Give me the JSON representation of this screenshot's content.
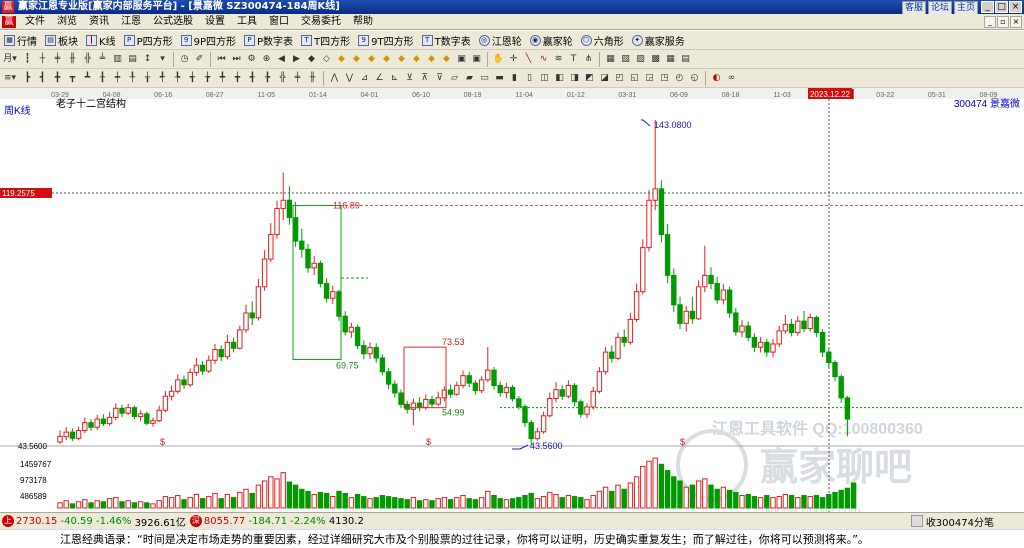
{
  "titlebar": {
    "title": "赢家江恩专业版[赢家内部服务平台] - [景嘉微  SZ300474-184周K线]",
    "links": [
      "客服",
      "论坛",
      "主页"
    ],
    "win_buttons": [
      "_",
      "□",
      "×"
    ]
  },
  "menu": {
    "items": [
      "文件",
      "浏览",
      "资讯",
      "江恩",
      "公式选股",
      "设置",
      "工具",
      "窗口",
      "交易委托",
      "帮助"
    ]
  },
  "toolbar1": {
    "items": [
      {
        "icon": "table-icon",
        "label": "行情"
      },
      {
        "icon": "blocks-icon",
        "label": "板块"
      },
      {
        "icon": "candle-icon",
        "label": "K线"
      },
      {
        "icon": "square-icon",
        "label": "P四方形"
      },
      {
        "icon": "square-9p-icon",
        "label": "9P四方形"
      },
      {
        "icon": "square-p-num-icon",
        "label": "P数字表"
      },
      {
        "icon": "square-t-icon",
        "label": "T四方形"
      },
      {
        "icon": "square-9t-icon",
        "label": "9T四方形"
      },
      {
        "icon": "square-t-num-icon",
        "label": "T数字表"
      },
      {
        "icon": "gann-wheel-icon",
        "label": "江恩轮"
      },
      {
        "icon": "winner-wheel-icon",
        "label": "赢家轮"
      },
      {
        "icon": "hexagon-icon",
        "label": "六角形"
      },
      {
        "icon": "winner-service-icon",
        "label": "赢家服务"
      }
    ]
  },
  "chart": {
    "period_label": "周K线",
    "structure_label": "老子十二宫结构",
    "code_label": "300474 景嘉微",
    "crosshair_date": "2023.12.22",
    "crosshair_price": "119.2575",
    "top_dates": [
      "03-29",
      "04-08",
      "06-16",
      "08-27",
      "11-05",
      "01-14",
      "04-01",
      "06-10",
      "08-19",
      "11-04",
      "01-12",
      "03-31",
      "06-09",
      "08-18",
      "11-03",
      "2023.12.22",
      "03-22",
      "05-31",
      "08-09"
    ],
    "price_labels": {
      "high": "143.0800",
      "resistance": "116.89",
      "box1_low": "69.75",
      "box2_high": "73.53",
      "box2_low": "54.99",
      "low": "43.5600",
      "axis_low": "43.5600"
    },
    "volume_labels": [
      "1459767",
      "973178",
      "486589"
    ],
    "watermark_top": "江恩工具软件  QQ:100800360",
    "watermark_big": "赢家聊吧",
    "watermark_url": "liaoba.yingjia.com",
    "dividend_mark": "$"
  },
  "statusbar": {
    "sh_value": "2730.15",
    "sh_change": "-40.59",
    "sh_pct": "-1.46%",
    "sh_vol": "3926.61亿",
    "sz_value": "8055.77",
    "sz_change": "-184.71",
    "sz_pct": "-2.24%",
    "sz_vol": "4130.2",
    "right_text": "收300474分笔"
  },
  "quote": {
    "text": "江恩经典语录：“时间是决定市场走势的重要因素，经过详细研究大市及个别股票的过往记录，你将可以证明，历史确实重复发生；而了解过往，你将可以预测将来。”。"
  },
  "chart_data": {
    "type": "candlestick",
    "title": "老子十二宫结构",
    "series_name": "300474 景嘉微 周K线",
    "ylim": [
      43.56,
      143.08
    ],
    "highlighted_levels": [
      143.08,
      116.89,
      73.53,
      69.75,
      54.99,
      43.56
    ],
    "candles": [
      {
        "o": 44.5,
        "c": 46.2,
        "h": 48.0,
        "l": 43.9
      },
      {
        "o": 46.1,
        "c": 47.5,
        "h": 49.0,
        "l": 45.0
      },
      {
        "o": 47.5,
        "c": 45.6,
        "h": 48.6,
        "l": 44.8
      },
      {
        "o": 45.6,
        "c": 48.0,
        "h": 49.2,
        "l": 45.0
      },
      {
        "o": 48.0,
        "c": 50.4,
        "h": 52.0,
        "l": 47.2
      },
      {
        "o": 50.4,
        "c": 49.0,
        "h": 51.5,
        "l": 47.8
      },
      {
        "o": 49.0,
        "c": 51.5,
        "h": 52.8,
        "l": 48.1
      },
      {
        "o": 51.5,
        "c": 50.1,
        "h": 53.0,
        "l": 49.4
      },
      {
        "o": 50.1,
        "c": 52.0,
        "h": 53.6,
        "l": 49.5
      },
      {
        "o": 52.0,
        "c": 54.8,
        "h": 56.3,
        "l": 51.2
      },
      {
        "o": 54.8,
        "c": 53.3,
        "h": 55.9,
        "l": 52.1
      },
      {
        "o": 53.3,
        "c": 55.0,
        "h": 56.2,
        "l": 52.8
      },
      {
        "o": 55.0,
        "c": 52.3,
        "h": 55.6,
        "l": 51.5
      },
      {
        "o": 52.3,
        "c": 53.1,
        "h": 54.2,
        "l": 50.8
      },
      {
        "o": 53.1,
        "c": 50.2,
        "h": 53.8,
        "l": 49.6
      },
      {
        "o": 50.2,
        "c": 51.0,
        "h": 52.0,
        "l": 49.1
      },
      {
        "o": 51.0,
        "c": 54.2,
        "h": 55.6,
        "l": 50.6
      },
      {
        "o": 54.2,
        "c": 58.5,
        "h": 60.1,
        "l": 53.6
      },
      {
        "o": 58.5,
        "c": 60.0,
        "h": 61.8,
        "l": 57.2
      },
      {
        "o": 60.0,
        "c": 63.5,
        "h": 65.2,
        "l": 59.3
      },
      {
        "o": 63.5,
        "c": 62.0,
        "h": 64.8,
        "l": 60.8
      },
      {
        "o": 62.0,
        "c": 65.8,
        "h": 67.0,
        "l": 61.3
      },
      {
        "o": 65.8,
        "c": 68.0,
        "h": 70.2,
        "l": 64.7
      },
      {
        "o": 68.0,
        "c": 66.2,
        "h": 69.3,
        "l": 65.0
      },
      {
        "o": 66.2,
        "c": 69.5,
        "h": 71.0,
        "l": 65.6
      },
      {
        "o": 69.5,
        "c": 72.8,
        "h": 74.5,
        "l": 68.4
      },
      {
        "o": 72.8,
        "c": 70.6,
        "h": 74.1,
        "l": 69.2
      },
      {
        "o": 70.6,
        "c": 75.0,
        "h": 77.3,
        "l": 69.8
      },
      {
        "o": 75.0,
        "c": 73.2,
        "h": 76.5,
        "l": 71.9
      },
      {
        "o": 73.2,
        "c": 78.8,
        "h": 80.1,
        "l": 72.8
      },
      {
        "o": 78.8,
        "c": 84.0,
        "h": 86.5,
        "l": 77.9
      },
      {
        "o": 84.0,
        "c": 82.5,
        "h": 87.6,
        "l": 80.3
      },
      {
        "o": 82.5,
        "c": 92.0,
        "h": 94.4,
        "l": 81.7
      },
      {
        "o": 92.0,
        "c": 100.5,
        "h": 103.2,
        "l": 90.8
      },
      {
        "o": 100.5,
        "c": 108.0,
        "h": 111.5,
        "l": 99.6
      },
      {
        "o": 108.0,
        "c": 116.0,
        "h": 118.4,
        "l": 106.7
      },
      {
        "o": 116.0,
        "c": 118.5,
        "h": 127.0,
        "l": 112.4
      },
      {
        "o": 118.5,
        "c": 113.2,
        "h": 122.8,
        "l": 111.0
      },
      {
        "o": 113.2,
        "c": 106.0,
        "h": 118.0,
        "l": 104.2
      },
      {
        "o": 106.0,
        "c": 103.5,
        "h": 109.8,
        "l": 100.9
      },
      {
        "o": 103.5,
        "c": 97.8,
        "h": 105.2,
        "l": 96.3
      },
      {
        "o": 97.8,
        "c": 99.2,
        "h": 101.5,
        "l": 95.6
      },
      {
        "o": 99.2,
        "c": 93.0,
        "h": 100.0,
        "l": 91.8
      },
      {
        "o": 93.0,
        "c": 88.5,
        "h": 94.6,
        "l": 87.2
      },
      {
        "o": 88.5,
        "c": 90.5,
        "h": 92.3,
        "l": 86.8
      },
      {
        "o": 90.5,
        "c": 83.0,
        "h": 91.1,
        "l": 81.6
      },
      {
        "o": 83.0,
        "c": 78.2,
        "h": 84.5,
        "l": 77.1
      },
      {
        "o": 78.2,
        "c": 79.6,
        "h": 81.0,
        "l": 76.4
      },
      {
        "o": 79.6,
        "c": 74.0,
        "h": 80.4,
        "l": 72.9
      },
      {
        "o": 74.0,
        "c": 71.5,
        "h": 75.6,
        "l": 69.8
      },
      {
        "o": 71.5,
        "c": 73.4,
        "h": 75.0,
        "l": 69.9
      },
      {
        "o": 73.4,
        "c": 70.2,
        "h": 74.7,
        "l": 68.8
      },
      {
        "o": 70.2,
        "c": 66.0,
        "h": 71.3,
        "l": 64.9
      },
      {
        "o": 66.0,
        "c": 62.2,
        "h": 67.1,
        "l": 60.6
      },
      {
        "o": 62.2,
        "c": 59.5,
        "h": 63.3,
        "l": 58.1
      },
      {
        "o": 59.5,
        "c": 56.0,
        "h": 60.6,
        "l": 54.8
      },
      {
        "o": 56.0,
        "c": 54.5,
        "h": 57.1,
        "l": 53.2
      },
      {
        "o": 54.5,
        "c": 56.4,
        "h": 57.8,
        "l": 49.6
      },
      {
        "o": 56.4,
        "c": 55.0,
        "h": 58.2,
        "l": 53.9
      },
      {
        "o": 55.0,
        "c": 57.5,
        "h": 59.0,
        "l": 54.3
      },
      {
        "o": 57.5,
        "c": 56.1,
        "h": 58.6,
        "l": 55.0
      },
      {
        "o": 56.1,
        "c": 58.0,
        "h": 59.9,
        "l": 55.5
      },
      {
        "o": 58.0,
        "c": 60.4,
        "h": 61.5,
        "l": 56.9
      },
      {
        "o": 60.4,
        "c": 59.1,
        "h": 62.0,
        "l": 58.0
      },
      {
        "o": 59.1,
        "c": 61.8,
        "h": 63.0,
        "l": 58.6
      },
      {
        "o": 61.8,
        "c": 64.8,
        "h": 66.4,
        "l": 60.9
      },
      {
        "o": 64.8,
        "c": 62.5,
        "h": 66.0,
        "l": 61.3
      },
      {
        "o": 62.5,
        "c": 60.2,
        "h": 63.4,
        "l": 59.0
      },
      {
        "o": 60.2,
        "c": 63.5,
        "h": 64.6,
        "l": 59.5
      },
      {
        "o": 63.5,
        "c": 66.5,
        "h": 73.53,
        "l": 62.8
      },
      {
        "o": 66.5,
        "c": 61.8,
        "h": 67.4,
        "l": 60.6
      },
      {
        "o": 61.8,
        "c": 59.6,
        "h": 63.0,
        "l": 58.4
      },
      {
        "o": 59.6,
        "c": 61.2,
        "h": 62.6,
        "l": 57.9
      },
      {
        "o": 61.2,
        "c": 57.7,
        "h": 62.0,
        "l": 56.8
      },
      {
        "o": 57.7,
        "c": 55.3,
        "h": 58.6,
        "l": 54.4
      },
      {
        "o": 55.3,
        "c": 50.4,
        "h": 56.0,
        "l": 49.1
      },
      {
        "o": 50.4,
        "c": 45.5,
        "h": 51.2,
        "l": 43.56
      },
      {
        "o": 45.5,
        "c": 47.6,
        "h": 48.8,
        "l": 44.9
      },
      {
        "o": 47.6,
        "c": 52.5,
        "h": 53.8,
        "l": 47.0
      },
      {
        "o": 52.5,
        "c": 57.8,
        "h": 59.6,
        "l": 52.0
      },
      {
        "o": 57.8,
        "c": 60.5,
        "h": 62.8,
        "l": 56.6
      },
      {
        "o": 60.5,
        "c": 58.5,
        "h": 61.8,
        "l": 57.4
      },
      {
        "o": 58.5,
        "c": 61.8,
        "h": 63.4,
        "l": 57.9
      },
      {
        "o": 61.8,
        "c": 56.8,
        "h": 62.5,
        "l": 55.4
      },
      {
        "o": 56.8,
        "c": 53.0,
        "h": 57.5,
        "l": 51.9
      },
      {
        "o": 53.0,
        "c": 55.2,
        "h": 56.3,
        "l": 51.8
      },
      {
        "o": 55.2,
        "c": 60.0,
        "h": 61.4,
        "l": 54.4
      },
      {
        "o": 60.0,
        "c": 66.0,
        "h": 67.4,
        "l": 59.3
      },
      {
        "o": 66.0,
        "c": 72.0,
        "h": 73.6,
        "l": 65.1
      },
      {
        "o": 72.0,
        "c": 70.1,
        "h": 74.0,
        "l": 68.8
      },
      {
        "o": 70.1,
        "c": 76.5,
        "h": 78.0,
        "l": 69.5
      },
      {
        "o": 76.5,
        "c": 75.0,
        "h": 78.9,
        "l": 73.6
      },
      {
        "o": 75.0,
        "c": 82.0,
        "h": 84.1,
        "l": 74.3
      },
      {
        "o": 82.0,
        "c": 90.5,
        "h": 93.0,
        "l": 81.2
      },
      {
        "o": 90.5,
        "c": 104.0,
        "h": 106.5,
        "l": 89.6
      },
      {
        "o": 104.0,
        "c": 118.5,
        "h": 121.6,
        "l": 102.8
      },
      {
        "o": 118.5,
        "c": 122.0,
        "h": 143.08,
        "l": 115.5
      },
      {
        "o": 122.0,
        "c": 108.0,
        "h": 124.6,
        "l": 105.6
      },
      {
        "o": 108.0,
        "c": 95.5,
        "h": 111.2,
        "l": 93.1
      },
      {
        "o": 95.5,
        "c": 86.5,
        "h": 97.6,
        "l": 84.2
      },
      {
        "o": 86.5,
        "c": 80.8,
        "h": 89.0,
        "l": 79.1
      },
      {
        "o": 80.8,
        "c": 84.5,
        "h": 86.1,
        "l": 78.3
      },
      {
        "o": 84.5,
        "c": 82.2,
        "h": 89.0,
        "l": 80.7
      },
      {
        "o": 82.2,
        "c": 92.0,
        "h": 94.0,
        "l": 81.8
      },
      {
        "o": 92.0,
        "c": 95.5,
        "h": 104.6,
        "l": 90.4
      },
      {
        "o": 95.5,
        "c": 93.0,
        "h": 98.0,
        "l": 91.2
      },
      {
        "o": 93.0,
        "c": 88.0,
        "h": 95.0,
        "l": 86.8
      },
      {
        "o": 88.0,
        "c": 91.0,
        "h": 92.8,
        "l": 86.6
      },
      {
        "o": 91.0,
        "c": 84.0,
        "h": 92.0,
        "l": 82.5
      },
      {
        "o": 84.0,
        "c": 78.2,
        "h": 85.5,
        "l": 77.0
      },
      {
        "o": 78.2,
        "c": 80.0,
        "h": 81.8,
        "l": 76.6
      },
      {
        "o": 80.0,
        "c": 76.5,
        "h": 81.4,
        "l": 75.3
      },
      {
        "o": 76.5,
        "c": 73.5,
        "h": 77.8,
        "l": 72.0
      },
      {
        "o": 73.5,
        "c": 75.0,
        "h": 76.6,
        "l": 71.9
      },
      {
        "o": 75.0,
        "c": 72.0,
        "h": 76.1,
        "l": 70.6
      },
      {
        "o": 72.0,
        "c": 74.5,
        "h": 76.0,
        "l": 70.5
      },
      {
        "o": 74.5,
        "c": 78.5,
        "h": 80.0,
        "l": 73.6
      },
      {
        "o": 78.5,
        "c": 80.5,
        "h": 83.4,
        "l": 77.6
      },
      {
        "o": 80.5,
        "c": 78.0,
        "h": 82.2,
        "l": 76.8
      },
      {
        "o": 78.0,
        "c": 81.5,
        "h": 83.0,
        "l": 77.0
      },
      {
        "o": 81.5,
        "c": 79.2,
        "h": 84.6,
        "l": 78.1
      },
      {
        "o": 79.2,
        "c": 82.6,
        "h": 83.8,
        "l": 78.3
      },
      {
        "o": 82.6,
        "c": 78.0,
        "h": 83.2,
        "l": 76.6
      },
      {
        "o": 78.0,
        "c": 72.0,
        "h": 79.0,
        "l": 70.5
      },
      {
        "o": 72.0,
        "c": 68.8,
        "h": 73.1,
        "l": 67.2
      },
      {
        "o": 68.8,
        "c": 64.5,
        "h": 69.5,
        "l": 63.0
      },
      {
        "o": 64.5,
        "c": 58.0,
        "h": 65.2,
        "l": 56.5
      },
      {
        "o": 58.0,
        "c": 51.5,
        "h": 58.6,
        "l": 46.2
      }
    ],
    "volume": [
      0.05,
      0.07,
      0.04,
      0.06,
      0.08,
      0.05,
      0.07,
      0.06,
      0.09,
      0.1,
      0.06,
      0.07,
      0.05,
      0.06,
      0.05,
      0.04,
      0.07,
      0.11,
      0.1,
      0.12,
      0.08,
      0.1,
      0.13,
      0.09,
      0.11,
      0.14,
      0.09,
      0.13,
      0.1,
      0.15,
      0.18,
      0.14,
      0.22,
      0.26,
      0.3,
      0.28,
      0.34,
      0.25,
      0.22,
      0.18,
      0.16,
      0.13,
      0.15,
      0.14,
      0.11,
      0.16,
      0.14,
      0.1,
      0.13,
      0.11,
      0.09,
      0.1,
      0.12,
      0.11,
      0.1,
      0.09,
      0.08,
      0.1,
      0.07,
      0.08,
      0.07,
      0.09,
      0.1,
      0.08,
      0.1,
      0.12,
      0.09,
      0.08,
      0.1,
      0.16,
      0.12,
      0.09,
      0.08,
      0.09,
      0.1,
      0.12,
      0.14,
      0.09,
      0.11,
      0.15,
      0.13,
      0.1,
      0.12,
      0.11,
      0.1,
      0.08,
      0.12,
      0.16,
      0.2,
      0.16,
      0.22,
      0.18,
      0.24,
      0.3,
      0.4,
      0.45,
      0.48,
      0.42,
      0.36,
      0.3,
      0.26,
      0.2,
      0.22,
      0.26,
      0.28,
      0.22,
      0.18,
      0.2,
      0.17,
      0.15,
      0.12,
      0.13,
      0.11,
      0.1,
      0.12,
      0.1,
      0.11,
      0.13,
      0.12,
      0.1,
      0.12,
      0.11,
      0.12,
      0.1,
      0.13,
      0.15,
      0.17,
      0.19,
      0.24
    ]
  }
}
